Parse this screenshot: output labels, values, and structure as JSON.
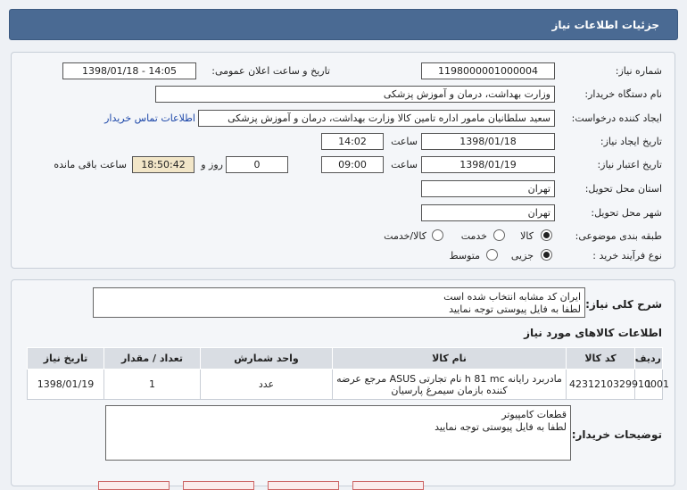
{
  "window": {
    "title": "جزئیات اطلاعات نیاز"
  },
  "form": {
    "need_number_label": "شماره نیاز:",
    "need_number": "1198000001000004",
    "announce_label": "تاریخ و ساعت اعلان عمومی:",
    "announce_value": "1398/01/18 - 14:05",
    "buyer_org_label": "نام دستگاه خریدار:",
    "buyer_org": "وزارت بهداشت، درمان و آموزش پزشکی",
    "requester_label": "ایجاد کننده درخواست:",
    "requester": "سعید سلطانیان مامور اداره تامین کالا وزارت بهداشت، درمان و آموزش پزشکی",
    "contact_link": "اطلاعات تماس خریدار",
    "created_label": "تاریخ ایجاد نیاز:",
    "created_date": "1398/01/18",
    "time_label": "ساعت",
    "created_time": "14:02",
    "validity_label": "تاریخ اعتبار نیاز:",
    "validity_date": "1398/01/19",
    "validity_time": "09:00",
    "days_value": "0",
    "days_label": "روز و",
    "remaining_time": "18:50:42",
    "remaining_label": "ساعت باقی مانده",
    "province_label": "استان محل تحویل:",
    "province": "تهران",
    "city_label": "شهر محل تحویل:",
    "city": "تهران",
    "category_label": "طبقه بندی موضوعی:",
    "category_options": [
      "کالا",
      "خدمت",
      "کالا/خدمت"
    ],
    "process_label": "نوع فرآیند خرید :",
    "process_options": [
      "جزیی",
      "متوسط"
    ]
  },
  "summary": {
    "label": "شرح کلی نیاز:",
    "text": "ایران کد مشابه انتخاب شده است\nلطفا به فایل پیوستی توجه نمایید"
  },
  "items_section": {
    "title": "اطلاعات کالاهای مورد نیاز",
    "columns": [
      "ردیف",
      "کد کالا",
      "نام کالا",
      "واحد شمارش",
      "تعداد / مقدار",
      "تاریخ نیاز"
    ],
    "rows": [
      {
        "row": "1",
        "code": "4231210329910001",
        "name": "مادربرد رایانه h 81 mc نام تجارتی ASUS مرجع عرضه کننده بازمان سیمرغ پارسیان",
        "unit": "عدد",
        "qty": "1",
        "date": "1398/01/19"
      }
    ]
  },
  "buyer_notes": {
    "label": "توضیحات خریدار:",
    "text": "قطعات کامپیوتر\nلطفا به فایل پیوستی توجه نمایید"
  },
  "colors": {
    "title_bar": "#4a6a93",
    "panel_bg": "#f4f6f9",
    "remaining_bg": "#f2e6c8",
    "link": "#1a45a8"
  }
}
